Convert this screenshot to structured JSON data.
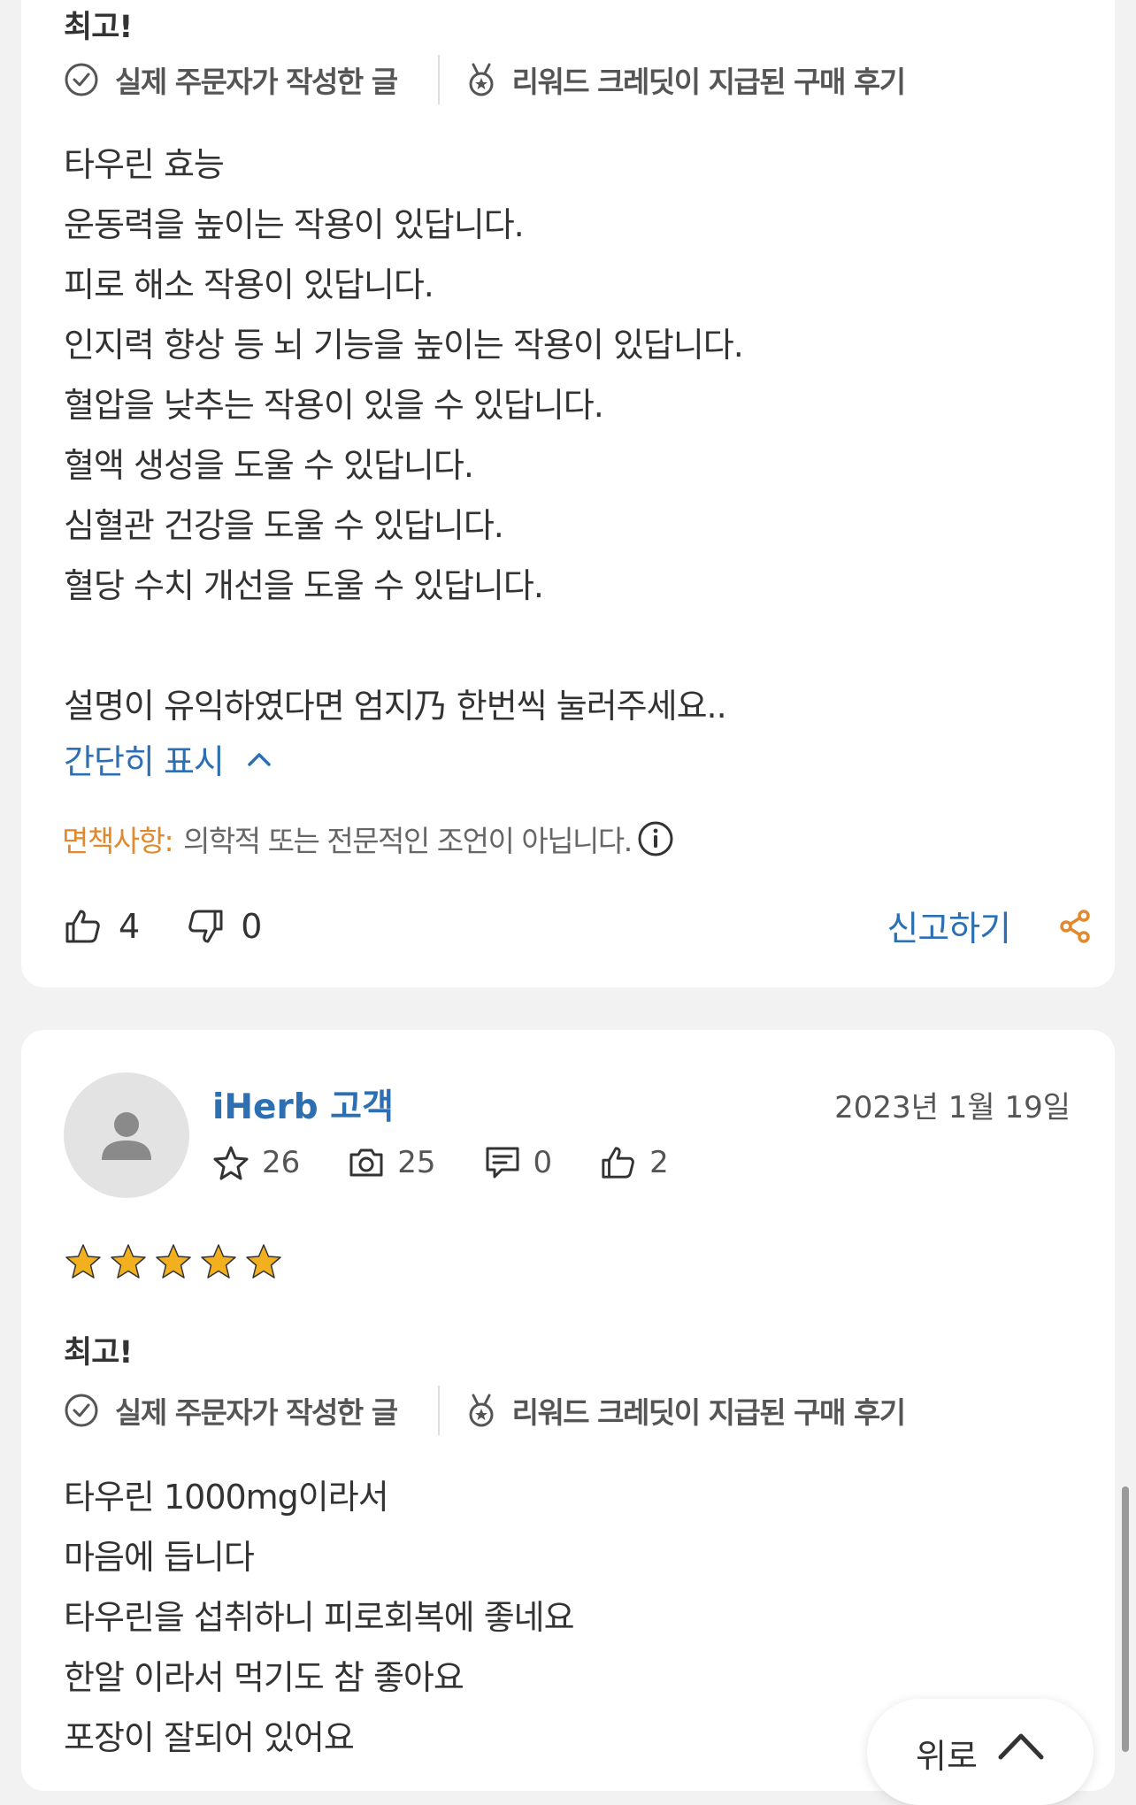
{
  "review1": {
    "title": "최고!",
    "badges": {
      "verified": "실제 주문자가 작성한 글",
      "rewards": "리워드 크레딧이 지급된 구매 후기"
    },
    "body_lines": [
      "타우린 효능",
      "운동력을 높이는 작용이 있답니다.",
      "피로 해소 작용이 있답니다.",
      "인지력 향상 등 뇌 기능을 높이는 작용이 있답니다.",
      "혈압을 낮추는 작용이 있을 수 있답니다.",
      "혈액 생성을 도울 수 있답니다.",
      "심혈관 건강을 도울 수 있답니다.",
      "혈당 수치 개선을 도울 수 있답니다.",
      "",
      "설명이 유익하였다면 엄지乃 한번씩 눌러주세요.."
    ],
    "collapse_label": "간단히 표시",
    "disclaimer": {
      "label": "면책사항:",
      "text": "의학적 또는 전문적인 조언이 아닙니다."
    },
    "helpful_count": "4",
    "unhelpful_count": "0",
    "report_label": "신고하기"
  },
  "review2": {
    "username": "iHerb 고객",
    "date": "2023년 1월 19일",
    "stats": {
      "reviews": "26",
      "photos": "25",
      "comments": "0",
      "likes": "2"
    },
    "rating": 5,
    "title": "최고!",
    "badges": {
      "verified": "실제 주문자가 작성한 글",
      "rewards": "리워드 크레딧이 지급된 구매 후기"
    },
    "body_lines": [
      "타우린 1000mg이라서",
      "마음에 듭니다",
      "타우린을 섭취하니 피로회복에 좋네요",
      "한알 이라서 먹기도 참 좋아요",
      "포장이 잘되어 있어요"
    ]
  },
  "back_to_top_label": "위로",
  "colors": {
    "link_blue": "#2c6fb3",
    "disclaimer_orange": "#e0892d",
    "share_orange": "#e0892d",
    "star_gold": "#f2b01e"
  },
  "icons": [
    "check-circle-icon",
    "medal-icon",
    "chevron-up-icon",
    "info-icon",
    "thumbs-up-icon",
    "thumbs-down-icon",
    "share-icon",
    "user-avatar-icon",
    "star-outline-icon",
    "camera-icon",
    "comment-icon",
    "star-icon"
  ]
}
